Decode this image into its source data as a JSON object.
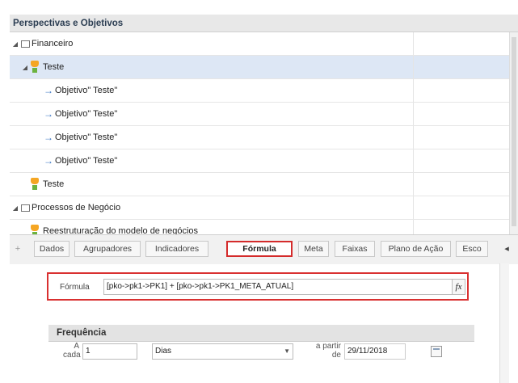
{
  "panel": {
    "title": "Perspectivas e Objetivos"
  },
  "tree": [
    {
      "label": "Financeiro",
      "type": "perspective",
      "expanded": true,
      "level": 0,
      "icon": "folder-icon"
    },
    {
      "label": "Teste",
      "type": "group",
      "expanded": true,
      "level": 1,
      "selected": true,
      "icon": "trophy-icon"
    },
    {
      "label": "Objetivo\" Teste\"",
      "type": "objective",
      "level": 2,
      "icon": "arrow-right-icon"
    },
    {
      "label": "Objetivo\" Teste\"",
      "type": "objective",
      "level": 2,
      "icon": "arrow-right-icon"
    },
    {
      "label": "Objetivo\" Teste\"",
      "type": "objective",
      "level": 2,
      "icon": "arrow-right-icon"
    },
    {
      "label": "Objetivo\" Teste\"",
      "type": "objective",
      "level": 2,
      "icon": "arrow-right-icon"
    },
    {
      "label": "Teste",
      "type": "group",
      "level": 1,
      "icon": "trophy-icon"
    },
    {
      "label": "Processos de Negócio",
      "type": "perspective",
      "expanded": true,
      "level": 0,
      "icon": "folder-icon"
    },
    {
      "label": "Reestruturação do modelo de negócios",
      "type": "group",
      "level": 1,
      "icon": "trophy-icon"
    }
  ],
  "tabs": [
    "Dados",
    "Agrupadores",
    "Indicadores",
    "Fórmula",
    "Meta",
    "Faixas",
    "Plano de Ação",
    "Esco"
  ],
  "active_tab": "Fórmula",
  "formula": {
    "label": "Fórmula",
    "value": "[pko->pk1->PK1] + [pko->pk1->PK1_META_ATUAL]",
    "button_label": "fx"
  },
  "frequency": {
    "title": "Frequência",
    "each_label_line1": "A",
    "each_label_line2": "cada",
    "each_value": "1",
    "unit_value": "Dias",
    "from_label_line1": "a partir",
    "from_label_line2": "de",
    "from_date": "29/11/2018"
  },
  "colors": {
    "highlight": "#d42b2b",
    "selected_row": "#dde7f5",
    "arrow": "#3a76c4"
  }
}
